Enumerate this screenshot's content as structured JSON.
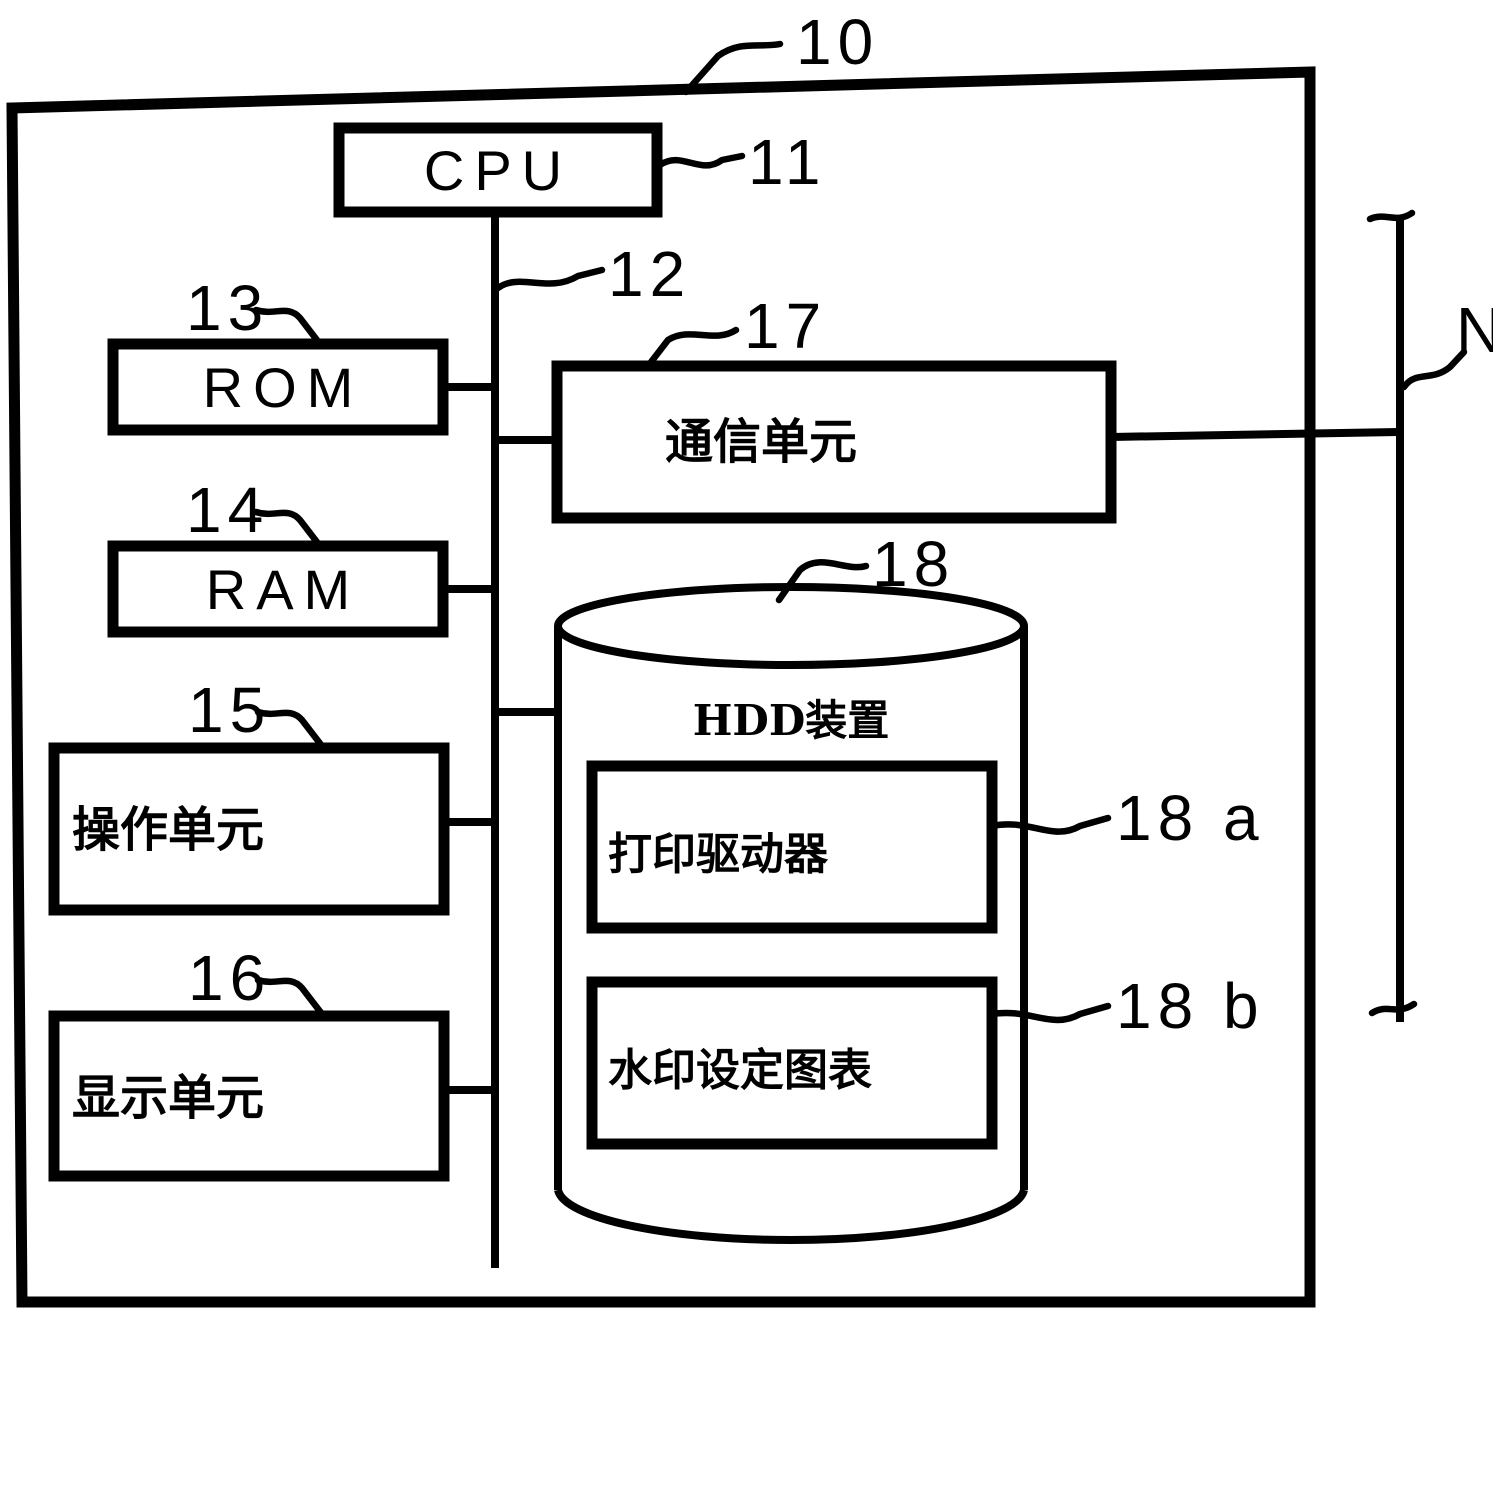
{
  "figure": {
    "type": "patent-block-diagram",
    "outer_frame_ref": "10",
    "network_ref": "N"
  },
  "blocks": {
    "cpu": {
      "label": "CPU",
      "ref": "11"
    },
    "bus": {
      "label": "",
      "ref": "12"
    },
    "rom": {
      "label": "ROM",
      "ref": "13"
    },
    "ram": {
      "label": "RAM",
      "ref": "14"
    },
    "operation_unit": {
      "label": "操作单元",
      "ref": "15"
    },
    "display_unit": {
      "label": "显示单元",
      "ref": "16"
    },
    "comm_unit": {
      "label": "通信单元",
      "ref": "17"
    },
    "hdd": {
      "label": "HDD装置",
      "ref": "18"
    },
    "print_driver": {
      "label": "打印驱动器",
      "ref": "18 a"
    },
    "watermark_table": {
      "label": "水印设定图表",
      "ref": "18 b"
    }
  },
  "refs": {
    "r10": "10",
    "r11": "11",
    "r12": "12",
    "r13": "13",
    "r14": "14",
    "r15": "15",
    "r16": "16",
    "r17": "17",
    "r18": "18",
    "r18a": "18 a",
    "r18b": "18 b",
    "rN": "N"
  },
  "colors": {
    "ink": "#000000",
    "paper": "#ffffff"
  }
}
